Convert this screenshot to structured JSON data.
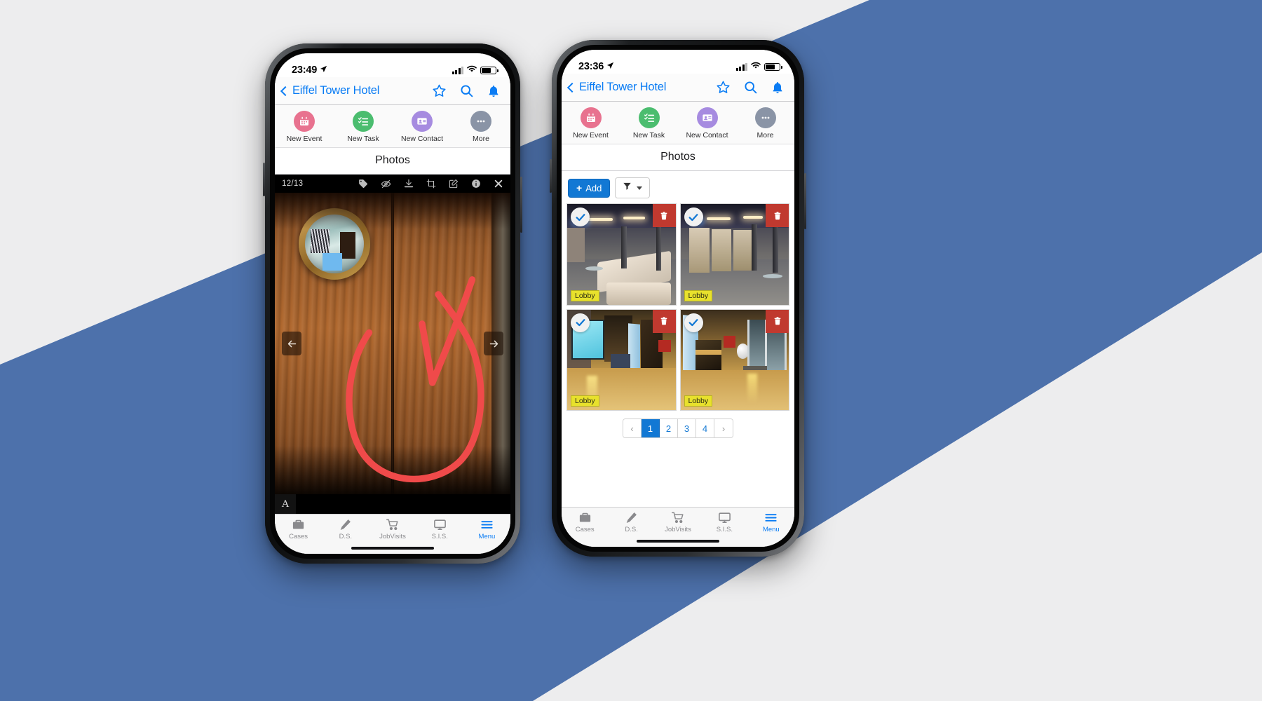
{
  "background": {
    "base_color": "#ededee",
    "accent_color": "#4d71ab"
  },
  "phone_left": {
    "status": {
      "time": "23:49",
      "location_icon": "location-arrow-icon",
      "signal": "signal-bars-icon",
      "wifi": "wifi-icon",
      "battery": "battery-icon"
    },
    "nav": {
      "back_label": "Eiffel Tower Hotel",
      "back_icon": "chevron-left-icon",
      "actions": [
        "star-icon",
        "search-icon",
        "bell-icon"
      ]
    },
    "quick_actions": [
      {
        "label": "New Event",
        "icon": "calendar-icon",
        "color": "#e8728f"
      },
      {
        "label": "New Task",
        "icon": "checklist-icon",
        "color": "#4bbd6f"
      },
      {
        "label": "New Contact",
        "icon": "contact-card-icon",
        "color": "#a68be0"
      },
      {
        "label": "More",
        "icon": "ellipsis-icon",
        "color": "#8a94a6"
      }
    ],
    "section_title": "Photos",
    "viewer": {
      "counter": "12/13",
      "toolbar_icons": [
        "tag-icon",
        "eye-slash-icon",
        "download-icon",
        "crop-icon",
        "edit-icon",
        "info-icon",
        "close-icon"
      ],
      "prev_icon": "arrow-left-icon",
      "next_icon": "arrow-right-icon",
      "annotate_tool_label": "A",
      "photo_description": "wooden double door with round porthole window and red annotation markup"
    },
    "tabs": [
      {
        "label": "Cases",
        "icon": "briefcase-icon",
        "active": false
      },
      {
        "label": "D.S.",
        "icon": "pencil-icon",
        "active": false
      },
      {
        "label": "JobVisits",
        "icon": "cart-icon",
        "active": false
      },
      {
        "label": "S.I.S.",
        "icon": "monitor-icon",
        "active": false
      },
      {
        "label": "Menu",
        "icon": "hamburger-icon",
        "active": true
      }
    ]
  },
  "phone_right": {
    "status": {
      "time": "23:36",
      "location_icon": "location-arrow-icon",
      "signal": "signal-bars-icon",
      "wifi": "wifi-icon",
      "battery": "battery-icon"
    },
    "nav": {
      "back_label": "Eiffel Tower Hotel",
      "back_icon": "chevron-left-icon",
      "actions": [
        "star-icon",
        "search-icon",
        "bell-icon"
      ]
    },
    "quick_actions": [
      {
        "label": "New Event",
        "icon": "calendar-icon",
        "color": "#e8728f"
      },
      {
        "label": "New Task",
        "icon": "checklist-icon",
        "color": "#4bbd6f"
      },
      {
        "label": "New Contact",
        "icon": "contact-card-icon",
        "color": "#a68be0"
      },
      {
        "label": "More",
        "icon": "ellipsis-icon",
        "color": "#8a94a6"
      }
    ],
    "section_title": "Photos",
    "toolbar": {
      "add_label": "Add",
      "add_icon": "plus-icon",
      "add_color": "#1278d4",
      "filter_icon": "funnel-icon",
      "filter_caret_icon": "caret-down-icon"
    },
    "photos": [
      {
        "tag": "Lobby",
        "selected": true,
        "check_icon": "check-icon",
        "delete_icon": "trash-icon",
        "description": "hotel lobby with long cream sofa"
      },
      {
        "tag": "Lobby",
        "selected": true,
        "check_icon": "check-icon",
        "delete_icon": "trash-icon",
        "description": "hotel lobby elevator bank"
      },
      {
        "tag": "Lobby",
        "selected": true,
        "check_icon": "check-icon",
        "delete_icon": "trash-icon",
        "description": "lobby corridor with screen display"
      },
      {
        "tag": "Lobby",
        "selected": true,
        "check_icon": "check-icon",
        "delete_icon": "trash-icon",
        "description": "lobby entrance glass doors"
      }
    ],
    "pagination": {
      "prev_label": "‹",
      "next_label": "›",
      "pages": [
        "1",
        "2",
        "3",
        "4"
      ],
      "active_page": "1"
    },
    "tabs": [
      {
        "label": "Cases",
        "icon": "briefcase-icon",
        "active": false
      },
      {
        "label": "D.S.",
        "icon": "pencil-icon",
        "active": false
      },
      {
        "label": "JobVisits",
        "icon": "cart-icon",
        "active": false
      },
      {
        "label": "S.I.S.",
        "icon": "monitor-icon",
        "active": false
      },
      {
        "label": "Menu",
        "icon": "hamburger-icon",
        "active": true
      }
    ]
  }
}
